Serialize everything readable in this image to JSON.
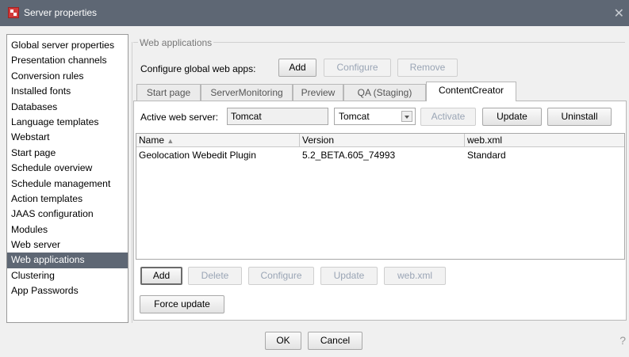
{
  "window": {
    "title": "Server properties",
    "close_glyph": "✕"
  },
  "sidebar": {
    "items": [
      {
        "label": "Global server properties"
      },
      {
        "label": "Presentation channels"
      },
      {
        "label": "Conversion rules"
      },
      {
        "label": "Installed fonts"
      },
      {
        "label": "Databases"
      },
      {
        "label": "Language templates"
      },
      {
        "label": "Webstart"
      },
      {
        "label": "Start page"
      },
      {
        "label": "Schedule overview"
      },
      {
        "label": "Schedule management"
      },
      {
        "label": "Action templates"
      },
      {
        "label": "JAAS configuration"
      },
      {
        "label": "Modules"
      },
      {
        "label": "Web server"
      },
      {
        "label": "Web applications",
        "selected": true
      },
      {
        "label": "Clustering"
      },
      {
        "label": "App Passwords"
      }
    ]
  },
  "web_apps": {
    "group_title": "Web applications",
    "global_label": "Configure global web apps:",
    "add": "Add",
    "configure": "Configure",
    "remove": "Remove"
  },
  "tabs": [
    {
      "label": "Start page"
    },
    {
      "label": "ServerMonitoring"
    },
    {
      "label": "Preview"
    },
    {
      "label": "QA (Staging)"
    },
    {
      "label": "ContentCreator",
      "active": true
    }
  ],
  "panel": {
    "active_server_label": "Active web server:",
    "active_server_value": "Tomcat",
    "server_select": "Tomcat",
    "activate": "Activate",
    "update": "Update",
    "uninstall": "Uninstall"
  },
  "table": {
    "columns": [
      "Name",
      "Version",
      "web.xml"
    ],
    "sort_glyph": "▲",
    "rows": [
      [
        "Geolocation Webedit Plugin",
        "5.2_BETA.605_74993",
        "Standard"
      ]
    ]
  },
  "table_buttons": {
    "add": "Add",
    "delete": "Delete",
    "configure": "Configure",
    "update": "Update",
    "webxml": "web.xml"
  },
  "force_update": "Force update",
  "dialog": {
    "ok": "OK",
    "cancel": "Cancel",
    "help_glyph": "?"
  }
}
